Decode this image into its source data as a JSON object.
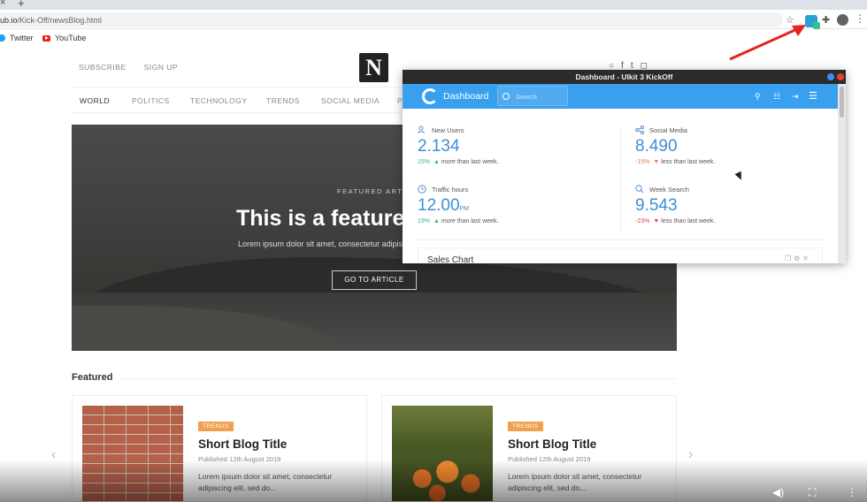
{
  "browser": {
    "url_host": "ub.io",
    "url_path": "/Kick-Off/newsBlog.html",
    "bookmarks": [
      {
        "label": "Twitter",
        "icon": "twitter-icon"
      },
      {
        "label": "YouTube",
        "icon": "youtube-icon"
      }
    ]
  },
  "blog": {
    "top_links": [
      "SUBSCRIBE",
      "SIGN UP"
    ],
    "logo_letter": "N",
    "nav": [
      "WORLD",
      "POLITICS",
      "TECHNOLOGY",
      "TRENDS",
      "SOCIAL MEDIA",
      "P"
    ],
    "hero": {
      "kicker": "FEATURED ARTIC",
      "title": "This is a featured",
      "subtitle": "Lorem ipsum dolor sit amet, consectetur adipisc",
      "button": "GO TO ARTICLE"
    },
    "featured_heading": "Featured",
    "cards": [
      {
        "badge": "TRENDS",
        "title": "Short Blog Title",
        "date": "Published 12th August 2019",
        "excerpt_line1": "Lorem ipsum dolor sit amet, consectetur",
        "excerpt_line2": "adipiscing elit, sed do..."
      },
      {
        "badge": "TRENDS",
        "title": "Short Blog Title",
        "date": "Published 12th August 2019",
        "excerpt_line1": "Lorem ipsum dolor sit amet, consectetur",
        "excerpt_line2": "adipiscing elit, sed do..."
      }
    ]
  },
  "popup": {
    "window_title": "Dashboard - UIkit 3 KickOff",
    "brand": "Dashboard",
    "search_placeholder": "Search",
    "stats": [
      {
        "label": "New Users",
        "value": "2.134",
        "unit": "",
        "delta": "15%",
        "delta_text": "more than last week.",
        "trend": "up",
        "icon": "users-icon"
      },
      {
        "label": "Social Media",
        "value": "8.490",
        "unit": "",
        "delta": "-15%",
        "delta_text": "less than last week.",
        "trend": "down",
        "icon": "share-icon"
      },
      {
        "label": "Traffic hours",
        "value": "12.00",
        "unit": "PM",
        "delta": "19%",
        "delta_text": "more than last week.",
        "trend": "up",
        "icon": "clock-icon"
      },
      {
        "label": "Week Search",
        "value": "9.543",
        "unit": "",
        "delta": "-23%",
        "delta_text": "less than last week.",
        "trend": "down",
        "icon": "search-icon"
      }
    ],
    "sales_chart_title": "Sales Chart"
  },
  "colors": {
    "accent": "#39a0f0",
    "stat_value": "#3d8fd6",
    "up": "#32b88a",
    "down": "#e67c44",
    "badge": "#f0a050"
  }
}
